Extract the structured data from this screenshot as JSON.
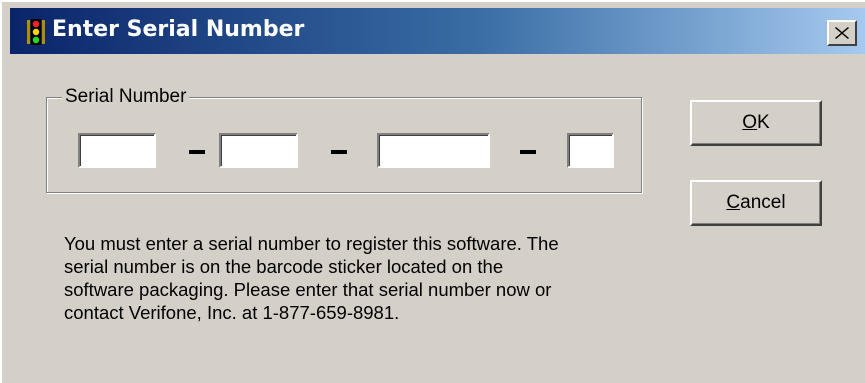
{
  "window": {
    "title": "Enter Serial Number",
    "close_icon": "close-icon"
  },
  "group": {
    "label": "Serial Number"
  },
  "serial_fields": [
    {
      "value": "",
      "placeholder": ""
    },
    {
      "value": "",
      "placeholder": ""
    },
    {
      "value": "",
      "placeholder": ""
    },
    {
      "value": "",
      "placeholder": ""
    }
  ],
  "separator": "-",
  "buttons": {
    "ok": {
      "mnemonic": "O",
      "rest": "K"
    },
    "cancel": {
      "mnemonic": "C",
      "rest": "ancel"
    }
  },
  "instructions": {
    "lines": [
      "You must enter a serial number to register this software. The",
      "serial number is on the barcode sticker located on the",
      "software packaging. Please enter that serial number now or",
      "contact Verifone, Inc. at 1-877-659-8981."
    ]
  },
  "colors": {
    "title_gradient_start": "#0a246a",
    "title_gradient_end": "#a6caf0",
    "dialog_background": "#d4d0c8"
  },
  "icons": {
    "app": "traffic-light-icon"
  }
}
